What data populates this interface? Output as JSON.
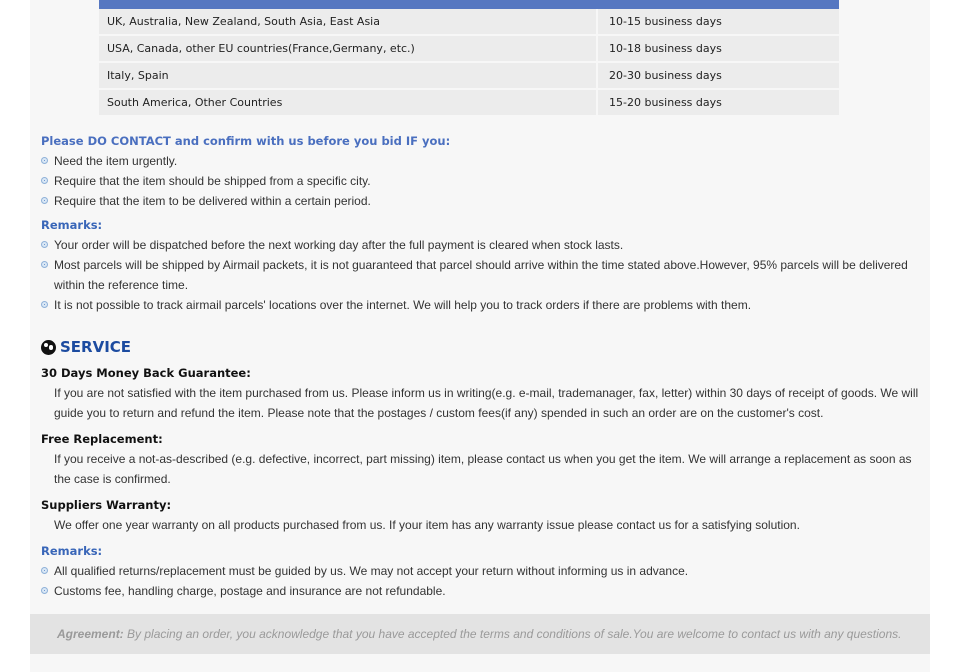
{
  "shipping_table": {
    "rows": [
      {
        "region": "UK, Australia, New Zealand, South Asia, East Asia",
        "time": "10-15 business days"
      },
      {
        "region": "USA, Canada, other EU countries(France,Germany, etc.)",
        "time": "10-18 business days"
      },
      {
        "region": "Italy, Spain",
        "time": "20-30 business days"
      },
      {
        "region": "South America, Other Countries",
        "time": "15-20 business days"
      }
    ]
  },
  "contact": {
    "title": "Please DO CONTACT and confirm with us before you bid IF you:",
    "items": [
      "Need the item urgently.",
      "Require that the item should be shipped from a specific city.",
      "Require that the item to be delivered within a certain period."
    ]
  },
  "remarks1": {
    "title": "Remarks:",
    "items": [
      "Your order will be dispatched before the next working day after the full payment is cleared when stock lasts.",
      "Most parcels will be shipped by Airmail packets, it is not guaranteed that parcel should arrive within the time stated above.However, 95% parcels will be delivered within the reference time.",
      "It is not possible to track airmail parcels' locations over the internet. We will help you to track orders if there are problems with them."
    ]
  },
  "service": {
    "title": "SERVICE",
    "money_back": {
      "title": "30 Days Money Back Guarantee:",
      "text": "If you are not satisfied with the item purchased from us. Please inform us in writing(e.g. e-mail, trademanager, fax, letter) within 30 days of receipt of goods. We will guide you to return and refund the item. Please note that the postages / custom fees(if any) spended in such an order are on the customer's cost."
    },
    "replacement": {
      "title": "Free Replacement:",
      "text": "If you receive a not-as-described (e.g. defective, incorrect, part missing) item, please contact us when you get the item. We will arrange a replacement as soon as the case is confirmed."
    },
    "warranty": {
      "title": "Suppliers Warranty:",
      "text": "We offer one year warranty on all products purchased from us. If your item has any warranty issue please contact us for a satisfying solution."
    }
  },
  "remarks2": {
    "title": "Remarks:",
    "items": [
      "All qualified returns/replacement must be guided by us. We may not accept your return without informing us in advance.",
      "Customs fee, handling charge, postage and insurance are not refundable."
    ]
  },
  "agreement": {
    "label": "Agreement:",
    "text": " By placing an order, you acknowledge that you have accepted the terms and conditions of sale.You are welcome to contact us with any questions."
  }
}
